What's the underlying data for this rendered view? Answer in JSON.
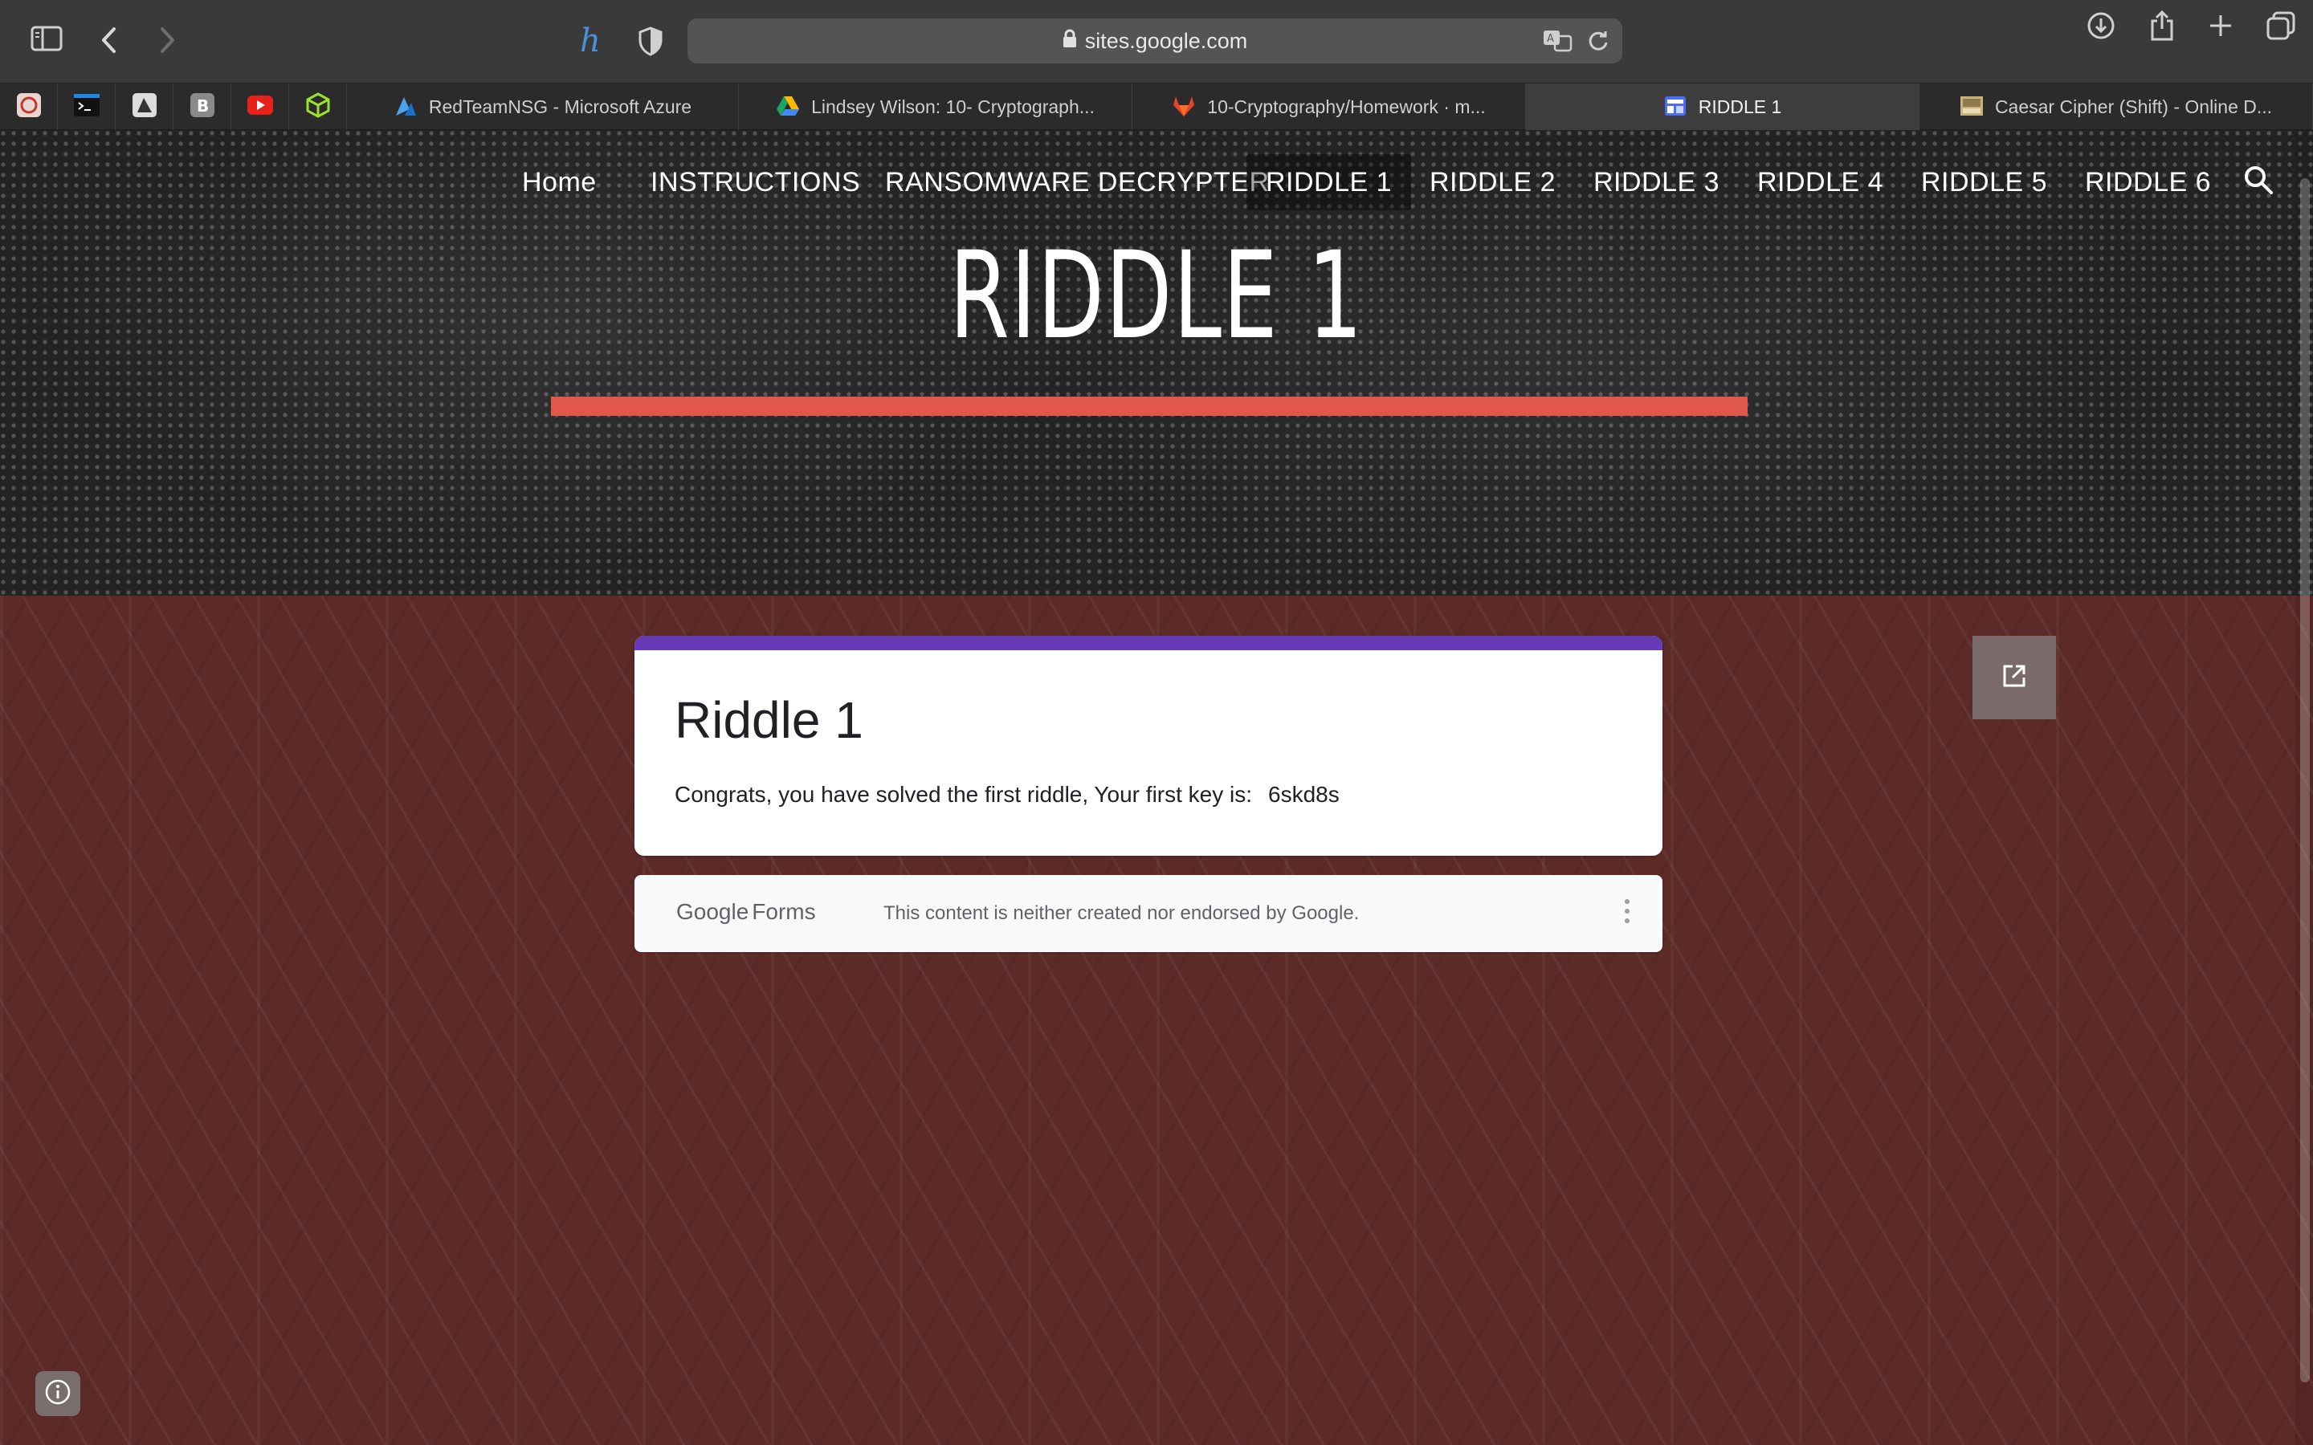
{
  "browser": {
    "url": "sites.google.com",
    "tabs": [
      {
        "label": "RedTeamNSG - Microsoft Azure",
        "icon": "azure-icon"
      },
      {
        "label": "Lindsey Wilson: 10- Cryptograph...",
        "icon": "google-drive-icon"
      },
      {
        "label": "10-Cryptography/Homework · m...",
        "icon": "gitlab-icon"
      },
      {
        "label": "RIDDLE 1",
        "icon": "google-sites-icon",
        "active": true
      },
      {
        "label": "Caesar Cipher (Shift) - Online D...",
        "icon": "dcode-icon"
      }
    ],
    "pinned_tabs": [
      "pinned-app-icon",
      "terminal-icon",
      "pinned-app-icon",
      "bootstrap-icon",
      "youtube-icon",
      "package-icon"
    ]
  },
  "site": {
    "nav": [
      "Home",
      "INSTRUCTIONS",
      "RANSOMWARE DECRYPTER",
      "RIDDLE 1",
      "RIDDLE 2",
      "RIDDLE 3",
      "RIDDLE 4",
      "RIDDLE 5",
      "RIDDLE 6"
    ],
    "active_nav": "RIDDLE 1",
    "hero_title": "RIDDLE 1",
    "accent_color": "#e2574c"
  },
  "form": {
    "title": "Riddle 1",
    "description": "Congrats, you have solved the first riddle, Your first key is:",
    "key": "6skd8s",
    "accent_color": "#673ab7",
    "footer": {
      "logo_google": "Google",
      "logo_forms": "Forms",
      "note": "This content is neither created nor endorsed by Google."
    }
  }
}
